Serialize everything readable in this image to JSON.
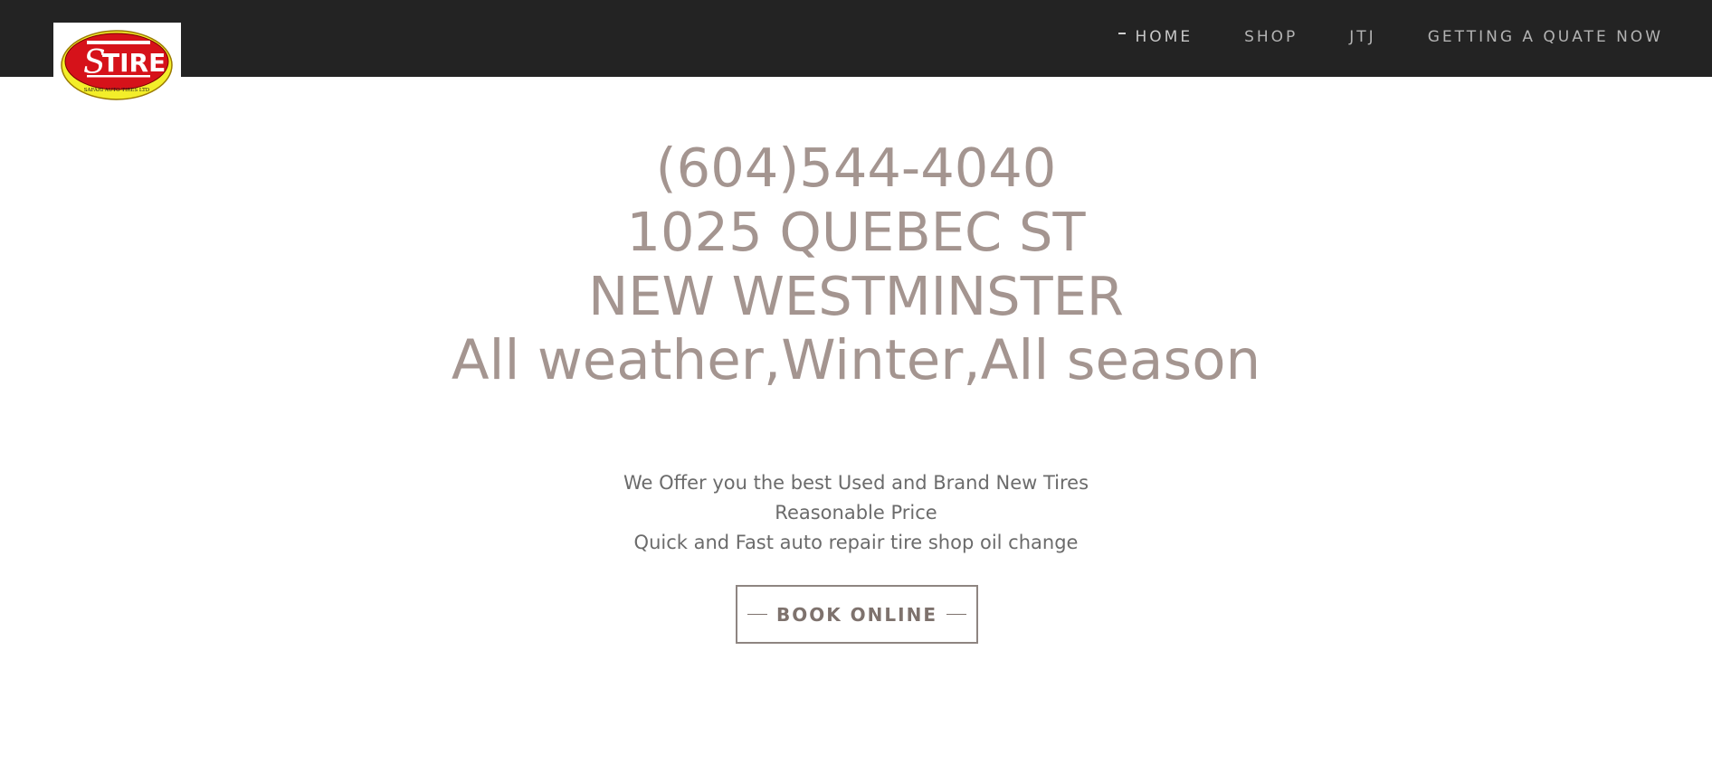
{
  "header": {
    "logo": {
      "text": "TIRE",
      "initial": "S",
      "subtext": "SAFARI AUTO TIRES LTD",
      "colors": {
        "red": "#d6121a",
        "yellow": "#f3ee2a",
        "white": "#ffffff"
      }
    },
    "nav": {
      "items": [
        {
          "label": "HOME",
          "active": true
        },
        {
          "label": "SHOP"
        },
        {
          "label": "JTJ"
        },
        {
          "label": "GETTING A QUATE NOW"
        }
      ]
    }
  },
  "hero": {
    "lines": [
      "(604)544-4040",
      "1025 QUEBEC ST",
      "NEW WESTMINSTER",
      "All weather,Winter,All season"
    ]
  },
  "description": {
    "lines": [
      "We Offer you the best Used and Brand New Tires",
      "Reasonable Price",
      "Quick and Fast auto repair tire shop oil change"
    ]
  },
  "cta": {
    "label": "BOOK ONLINE"
  },
  "colors": {
    "topbar": "#232323",
    "heading": "#a49590",
    "body_text": "#6b6b6b",
    "button_border": "#8e8581"
  }
}
